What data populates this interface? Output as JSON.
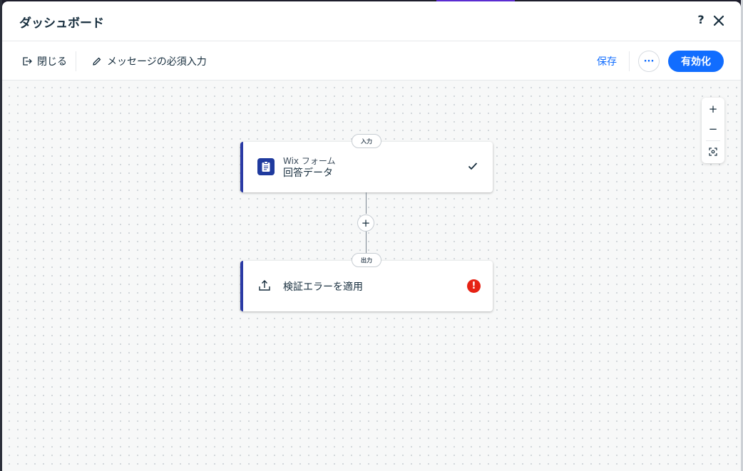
{
  "header": {
    "title": "ダッシュボード",
    "help_label": "?"
  },
  "toolbar": {
    "close_label": "閉じる",
    "edit_label": "メッセージの必須入力",
    "save_label": "保存",
    "more_label": "···",
    "activate_label": "有効化"
  },
  "canvas": {
    "zoom_in_label": "+",
    "zoom_out_label": "−",
    "trigger": {
      "tag": "入力",
      "subtitle": "Wix フォーム",
      "title": "回答データ",
      "icon": "form-clipboard-icon",
      "status_icon": "checkmark-icon"
    },
    "add_step_label": "+",
    "action": {
      "tag": "出力",
      "title": "検証エラーを適用",
      "icon": "upload-icon",
      "error_label": "!"
    }
  },
  "colors": {
    "accent": "#116dff",
    "node_border": "#2a3aa5",
    "error": "#e62214"
  }
}
